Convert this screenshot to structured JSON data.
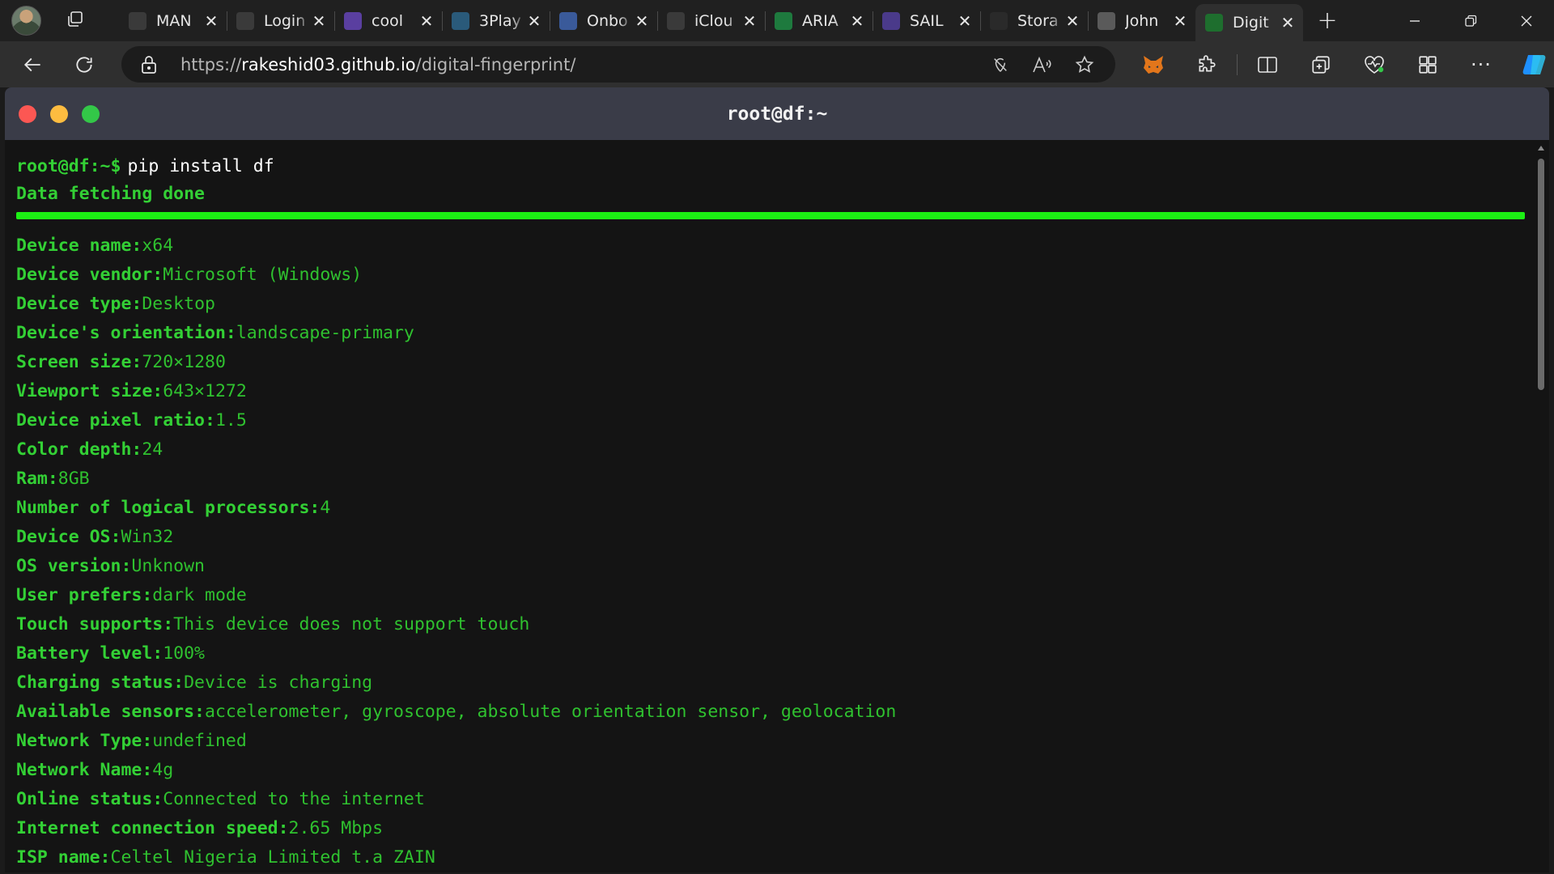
{
  "browser": {
    "tabs": [
      {
        "title": "MAN",
        "icon": "document-icon",
        "color": "#3a3a3a"
      },
      {
        "title": "Login",
        "icon": "site-icon",
        "color": "#3a3a3a"
      },
      {
        "title": "cool",
        "icon": "d-logo-icon",
        "color": "#5a3fa0"
      },
      {
        "title": "3Play",
        "icon": "3play-icon",
        "color": "#2a5a7a"
      },
      {
        "title": "Onbo",
        "icon": "onboard-icon",
        "color": "#3a5a9a"
      },
      {
        "title": "iClou",
        "icon": "apple-icon",
        "color": "#3a3a3a"
      },
      {
        "title": "ARIA",
        "icon": "aria-icon",
        "color": "#1e7a3e"
      },
      {
        "title": "SAIL",
        "icon": "list-icon",
        "color": "#4a3a8a"
      },
      {
        "title": "Stora",
        "icon": "drive-icon",
        "color": "#2a2a2a"
      },
      {
        "title": "John",
        "icon": "person-icon",
        "color": "#5a5a5a"
      },
      {
        "title": "Digit",
        "icon": "fingerprint-icon",
        "color": "#1e6e2e",
        "active": true
      }
    ],
    "url_prefix": "https://",
    "url_host": "rakeshid03.github.io",
    "url_path": "/digital-fingerprint/"
  },
  "terminal": {
    "title": "root@df:~",
    "prompt": "root@df:~$",
    "command": "pip install df",
    "status": "Data fetching done",
    "progress": 1.0,
    "info": [
      {
        "key": "Device name:",
        "value": "x64"
      },
      {
        "key": "Device vendor:",
        "value": "Microsoft (Windows)"
      },
      {
        "key": "Device type:",
        "value": "Desktop"
      },
      {
        "key": "Device's orientation:",
        "value": "landscape-primary"
      },
      {
        "key": "Screen size:",
        "value": "720×1280"
      },
      {
        "key": "Viewport size:",
        "value": "643×1272"
      },
      {
        "key": "Device pixel ratio:",
        "value": "1.5"
      },
      {
        "key": "Color depth:",
        "value": "24"
      },
      {
        "key": "Ram:",
        "value": "8GB"
      },
      {
        "key": "Number of logical processors:",
        "value": "4"
      },
      {
        "key": "Device OS:",
        "value": "Win32"
      },
      {
        "key": "OS version:",
        "value": "Unknown"
      },
      {
        "key": "User prefers:",
        "value": "dark mode"
      },
      {
        "key": "Touch supports:",
        "value": "This device does not support touch"
      },
      {
        "key": "Battery level:",
        "value": "100%"
      },
      {
        "key": "Charging status:",
        "value": "Device is charging"
      },
      {
        "key": "Available sensors:",
        "value": "accelerometer, gyroscope, absolute orientation sensor, geolocation"
      },
      {
        "key": "Network Type:",
        "value": "undefined"
      },
      {
        "key": "Network Name:",
        "value": "4g"
      },
      {
        "key": "Online status:",
        "value": "Connected to the internet"
      },
      {
        "key": "Internet connection speed:",
        "value": "2.65 Mbps"
      },
      {
        "key": "ISP name:",
        "value": "Celtel Nigeria Limited t.a ZAIN"
      }
    ]
  }
}
